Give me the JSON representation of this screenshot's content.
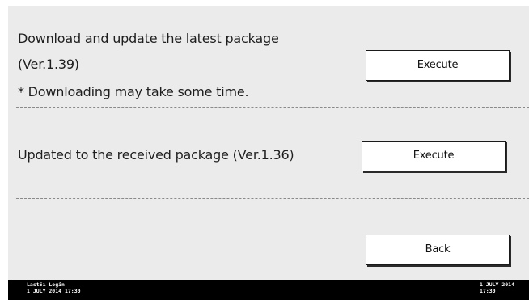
{
  "sections": {
    "download": {
      "line1": "Download and update the latest package",
      "line2": "(Ver.1.39)",
      "note": "* Downloading may take some time.",
      "button_label": "Execute"
    },
    "received": {
      "text": "Updated to the received package (Ver.1.36)",
      "button_label": "Execute"
    }
  },
  "back_button_label": "Back",
  "status_bar": {
    "left_line1": "Last5ı Login",
    "left_line2": "1 JULY 2014 17:30",
    "right_line1": "1 JULY 2014",
    "right_line2": "17:30"
  },
  "colors": {
    "panel_background": "#ebebeb",
    "status_bar_background": "#000000",
    "button_background": "#ffffff"
  }
}
